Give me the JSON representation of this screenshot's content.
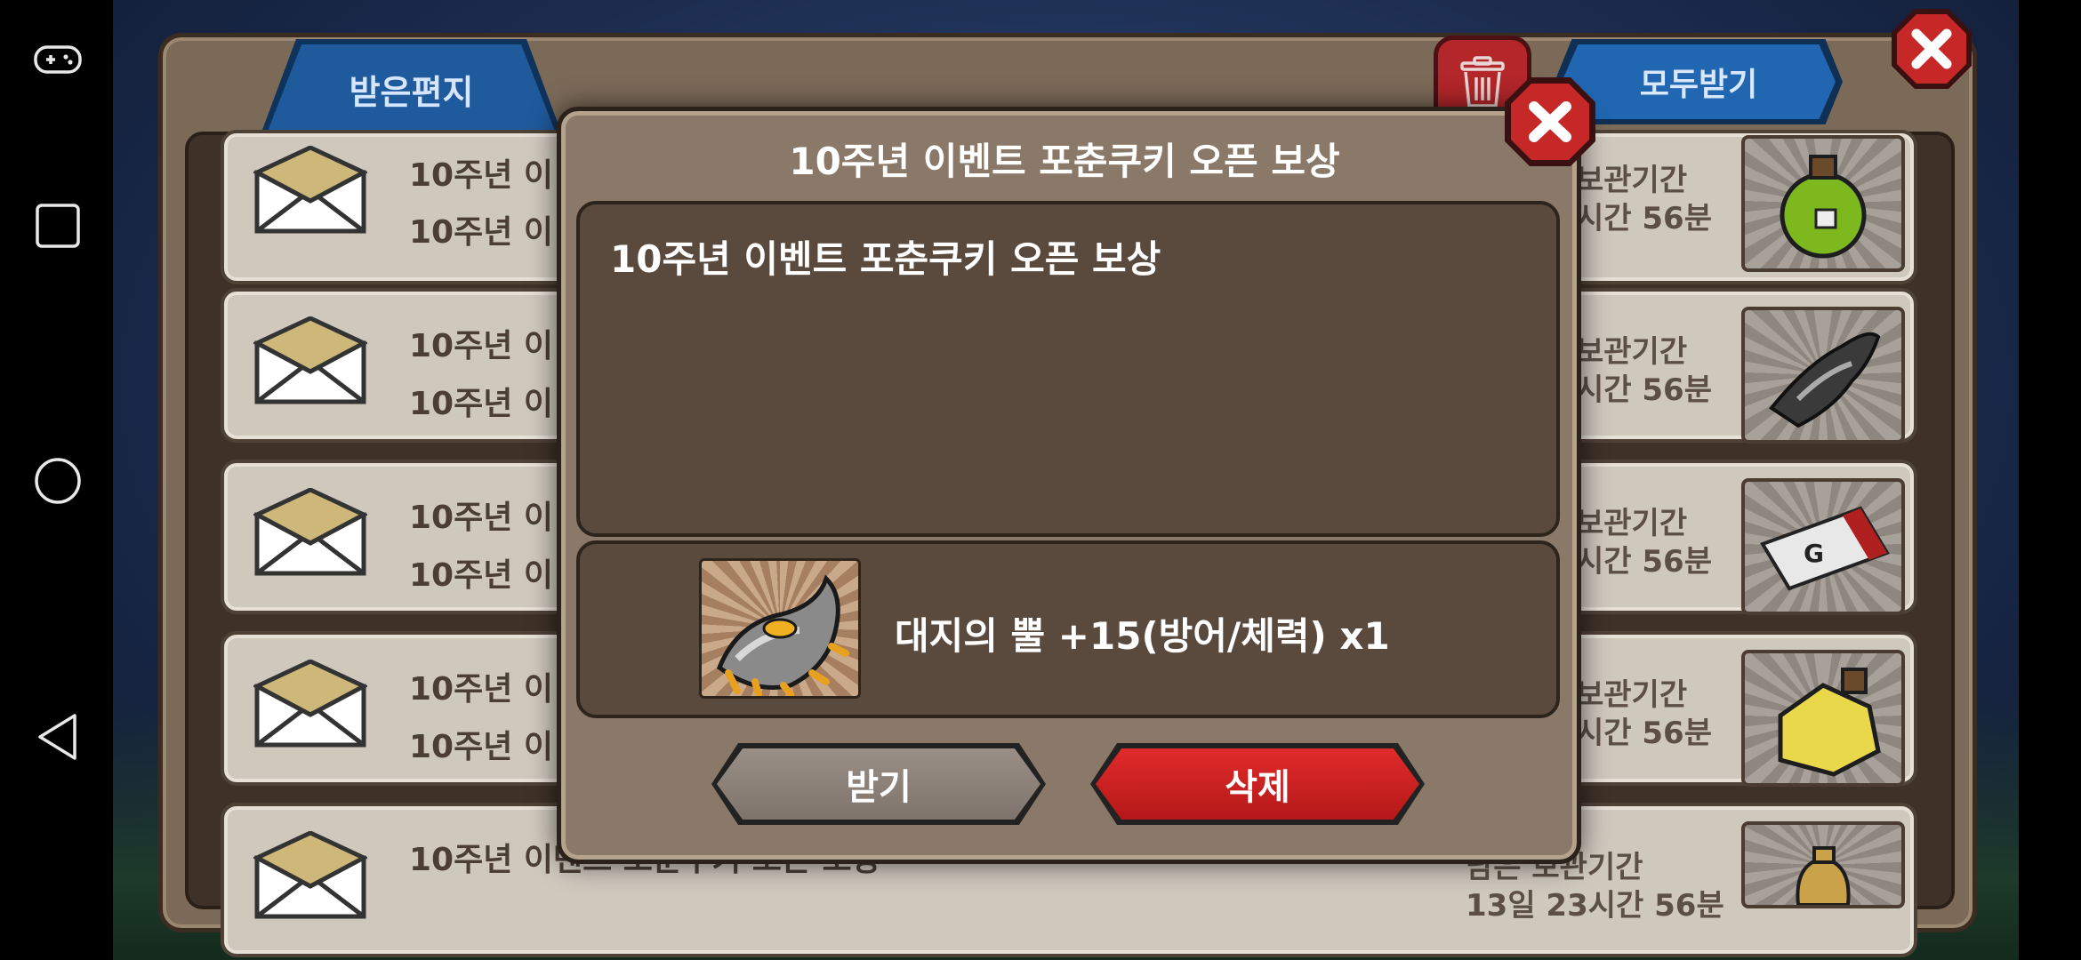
{
  "system_nav": {
    "icons": [
      "gamepad-icon",
      "recents-icon",
      "home-icon",
      "back-icon"
    ]
  },
  "mailbox": {
    "tab_label": "받은편지",
    "receive_all_label": "모두받기",
    "rows": [
      {
        "line1": "10주년 이",
        "line2": "10주년 이",
        "right1": "보관기간",
        "right2": "시간 56분"
      },
      {
        "line1": "10주년 이",
        "line2": "10주년 이",
        "right1": "보관기간",
        "right2": "시간 56분"
      },
      {
        "line1": "10주년 이",
        "line2": "10주년 이",
        "right1": "보관기간",
        "right2": "시간 56분"
      },
      {
        "line1": "10주년 이",
        "line2": "10주년 이",
        "right1": "보관기간",
        "right2": "시간 56분"
      },
      {
        "line1": "10주년 이벤트 포춘쿠키 오픈 보상",
        "line2": "",
        "right1": "남은 보관기간",
        "right2": "13일 23시간 56분"
      }
    ]
  },
  "dialog": {
    "title": "10주년 이벤트 포춘쿠키 오픈 보상",
    "message": "10주년 이벤트 포춘쿠키 오픈 보상",
    "item_label": "대지의 뿔 +15(방어/체력) x1",
    "receive_button": "받기",
    "delete_button": "삭제"
  },
  "colors": {
    "tab_blue": "#1f5a9c",
    "delete_red": "#c81f1f",
    "panel_brown": "#7b6a58"
  }
}
